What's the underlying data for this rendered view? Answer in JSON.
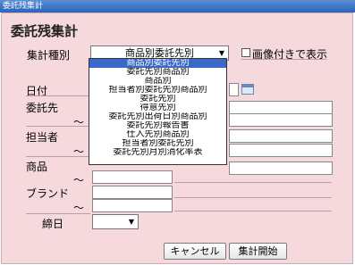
{
  "window": {
    "title": "委託残集計"
  },
  "heading": "委託残集計",
  "form": {
    "aggregation_type_label": "集計種別",
    "aggregation_type_value": "商品別委託先別",
    "image_option_label": "画像付きで表示",
    "date_label": "日付",
    "consignee_label": "委託先",
    "staff_label": "担当者",
    "product_label": "商品",
    "brand_label": "ブランド",
    "closing_day_label": "締日",
    "range_mark": "〜"
  },
  "dropdown_options": [
    "商品別委託先別",
    "委託先別商品別",
    "商品別",
    "担当者別委託先別商品別",
    "委託先別",
    "得意先別",
    "委託先別出荷日別商品別",
    "委託先別報告書",
    "仕入先別商品別",
    "担当者別委託先別",
    "委託先別月別消化率表"
  ],
  "buttons": {
    "cancel": "キャンセル",
    "start": "集計開始"
  }
}
